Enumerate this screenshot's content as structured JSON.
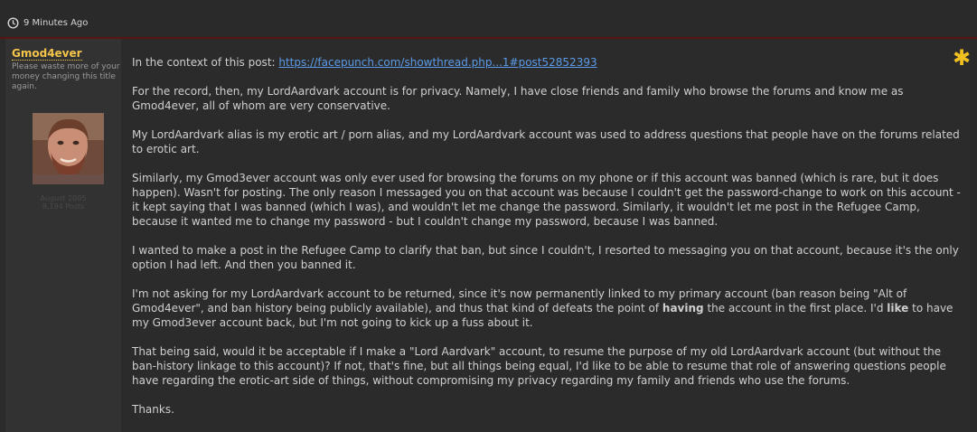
{
  "header": {
    "time": "9 Minutes Ago",
    "clock_icon": "clock-icon"
  },
  "user": {
    "name": "Gmod4ever",
    "title": "Please waste more of your money changing this title again.",
    "joined": "August 2005",
    "posts": "8,194 Posts",
    "avatar_icon": "user-photo"
  },
  "rate_icon": {
    "name": "star-icon",
    "glyph": "✱",
    "color": "#f0c020"
  },
  "post": {
    "context_prefix": "In the context of this post: ",
    "context_link": "https://facepunch.com/showthread.php...1#post52852393",
    "p1": "For the record, then, my LordAardvark account is for privacy. Namely, I have close friends and family who browse the forums and know me as Gmod4ever, all of whom are very conservative.",
    "p2": "My LordAardvark alias is my erotic art / porn alias, and my LordAardvark account was used to address questions that people have on the forums related to erotic art.",
    "p3": "Similarly, my Gmod3ever account was only ever used for browsing the forums on my phone or if this account was banned (which is rare, but it does happen). Wasn't for posting. The only reason I messaged you on that account was because I couldn't get the password-change to work on this account - it kept saying that I was banned (which I was), and wouldn't let me change the password. Similarly, it wouldn't let me post in the Refugee Camp, because it wanted me to change my password - but I couldn't change my password, because I was banned.",
    "p4": "I wanted to make a post in the Refugee Camp to clarify that ban, but since I couldn't, I resorted to messaging you on that account, because it's the only option I had left. And then you banned it.",
    "p5_a": "I'm not asking for my LordAardvark account to be returned, since it's now permanently linked to my primary account (ban reason being \"Alt of Gmod4ever\", and ban history being publicly available), and thus that kind of defeats the point of ",
    "p5_b": "having",
    "p5_c": " the account in the first place. I'd ",
    "p5_d": "like",
    "p5_e": " to have my Gmod3ever account back, but I'm not going to kick up a fuss about it.",
    "p6": "That being said, would it be acceptable if I make a \"Lord Aardvark\" account, to resume the purpose of my old LordAardvark account (but without the ban-history linkage to this account)? If not, that's fine, but all things being equal, I'd like to be able to resume that role of answering questions people have regarding the erotic-art side of things, without compromising my privacy regarding my family and friends who use the forums.",
    "p7": "Thanks."
  }
}
